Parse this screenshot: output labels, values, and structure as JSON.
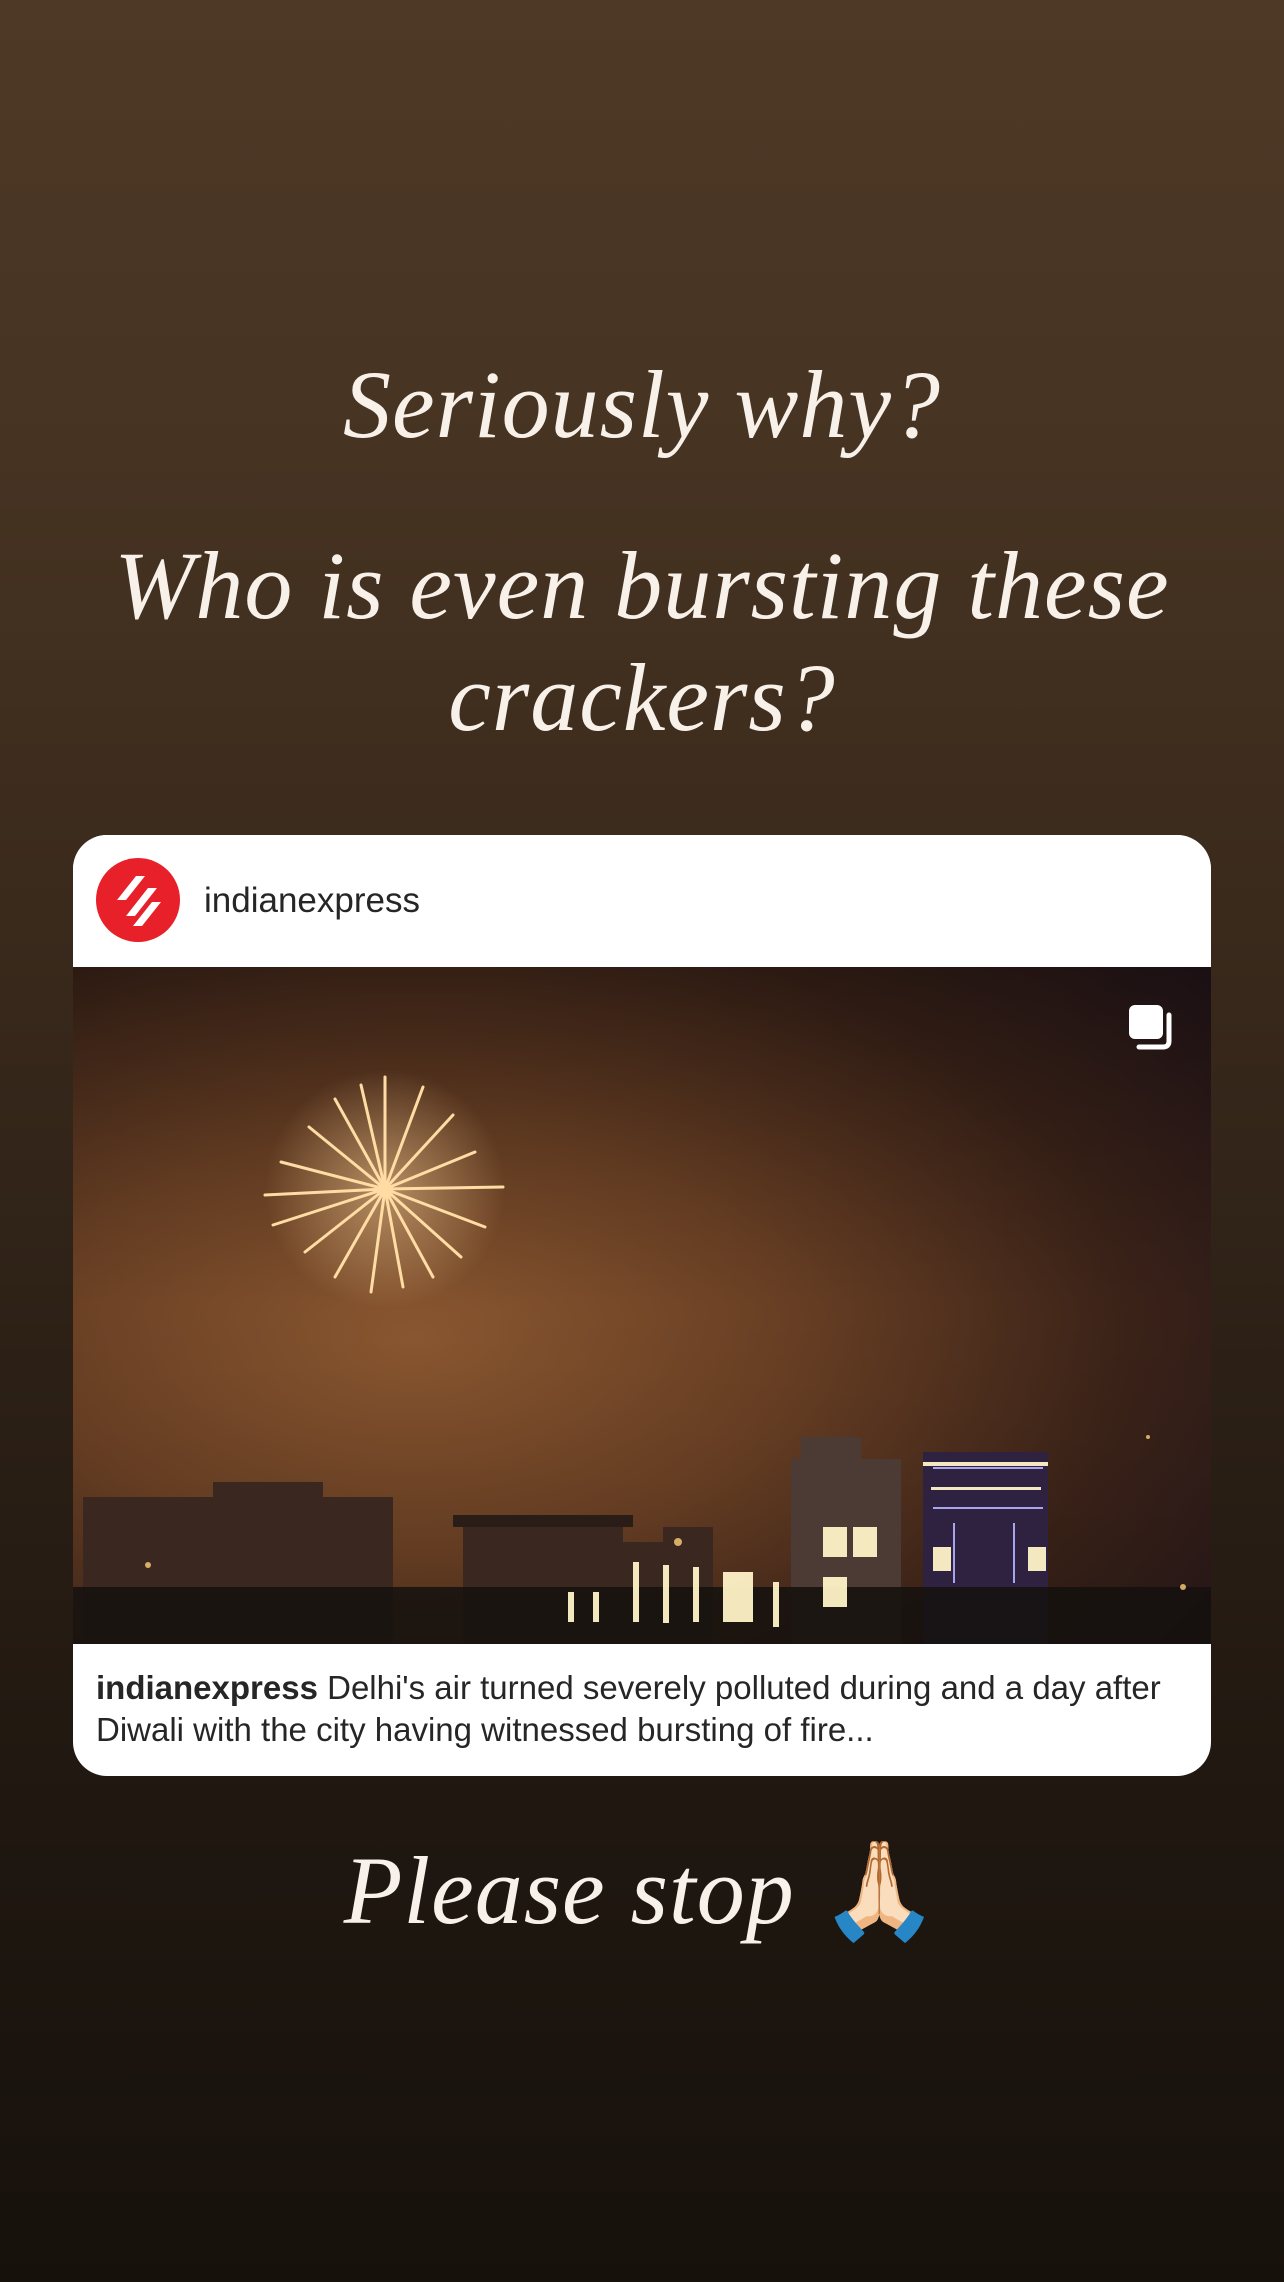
{
  "story": {
    "heading": "Seriously why?",
    "question": "Who is even bursting these crackers?",
    "closing": "Please stop",
    "closing_emoji": "🙏🏻"
  },
  "post": {
    "username": "indianexpress",
    "caption_user": "indianexpress",
    "caption_text": "Delhi's air turned severely polluted during and a day after Diwali with the city having witnessed bursting of fire...",
    "avatar_color": "#e8202a",
    "multi_icon": "carousel-stack-icon"
  }
}
